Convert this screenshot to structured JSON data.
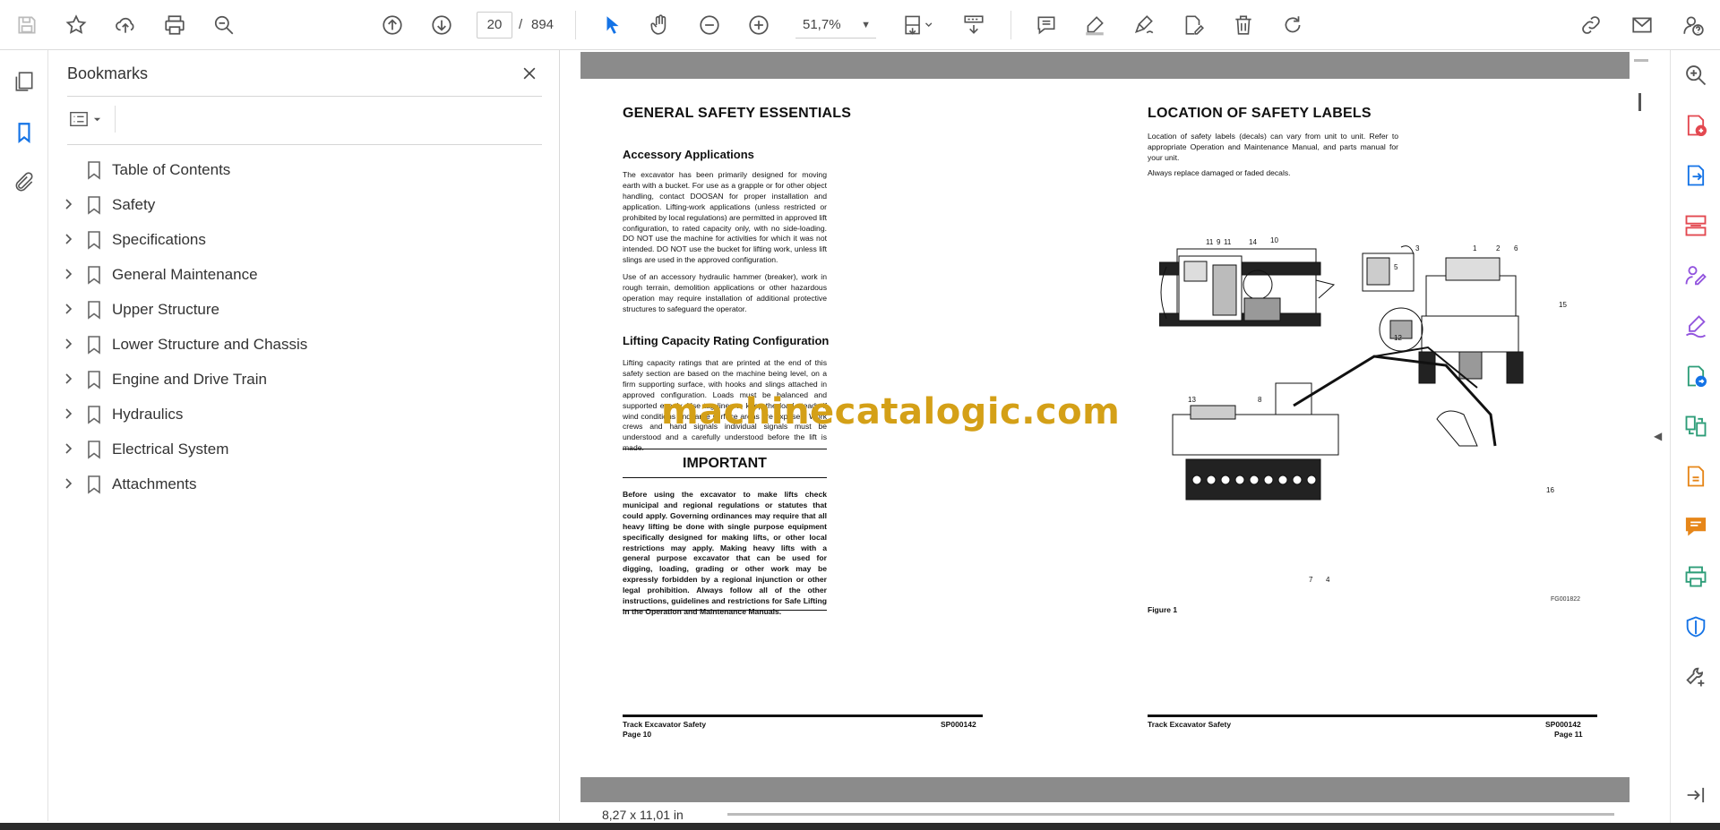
{
  "toolbar": {
    "current_page": "20",
    "page_sep": "/",
    "total_pages": "894",
    "zoom": "51,7%",
    "icons": [
      "save-icon",
      "star-icon",
      "upload-icon",
      "print-icon",
      "zoom-search-icon",
      "page-up-icon",
      "page-down-icon",
      "select-cursor-icon",
      "hand-icon",
      "zoom-out-icon",
      "zoom-in-icon",
      "fit-page-icon",
      "scroll-mode-icon",
      "comment-icon",
      "highlight-icon",
      "sign-icon",
      "fill-sign-icon",
      "delete-icon",
      "rotate-icon",
      "share-link-icon",
      "email-icon",
      "help-icon"
    ]
  },
  "bookmarks": {
    "title": "Bookmarks",
    "items": [
      {
        "label": "Table of Contents",
        "expandable": false
      },
      {
        "label": "Safety",
        "expandable": true
      },
      {
        "label": "Specifications",
        "expandable": true
      },
      {
        "label": "General Maintenance",
        "expandable": true
      },
      {
        "label": "Upper Structure",
        "expandable": true
      },
      {
        "label": "Lower Structure and Chassis",
        "expandable": true
      },
      {
        "label": "Engine and Drive Train",
        "expandable": true
      },
      {
        "label": "Hydraulics",
        "expandable": true
      },
      {
        "label": "Electrical System",
        "expandable": true
      },
      {
        "label": "Attachments",
        "expandable": true
      }
    ]
  },
  "left_page": {
    "title": "GENERAL SAFETY ESSENTIALS",
    "section1_heading": "Accessory Applications",
    "section1_para1": "The excavator has been primarily designed for moving earth with a bucket. For use as a grapple or for other object handling, contact DOOSAN for proper installation and application. Lifting-work applications (unless restricted or prohibited by local regulations) are permitted in approved lift configuration, to rated capacity only, with no side-loading. DO NOT use the machine for activities for which it was not intended. DO NOT use the bucket for lifting work, unless lift slings are used in the approved configuration.",
    "section1_para2": "Use of an accessory hydraulic hammer (breaker), work in rough terrain, demolition applications or other hazardous operation may require installation of additional protective structures to safeguard the operator.",
    "section2_heading": "Lifting Capacity Rating Configuration",
    "section2_para": "Lifting capacity ratings that are printed at the end of this safety section are based on the machine being level, on a firm supporting surface, with hooks and slings attached in approved configuration. Loads must be balanced and supported evenly. Use tag lines to keep the load steady if wind conditions and large surface areas are exposed. Work crews and hand signals individual signals must be understood and a carefully understood before the lift is made.",
    "important_heading": "IMPORTANT",
    "important_text": "Before using the excavator to make lifts check municipal and regional regulations or statutes that could apply. Governing ordinances may require that all heavy lifting be done with single purpose equipment specifically designed for making lifts, or other local restrictions may apply. Making heavy lifts with a general purpose excavator that can be used for digging, loading, grading or other work may be expressly forbidden by a regional injunction or other legal prohibition. Always follow all of the other instructions, guidelines and restrictions for Safe Lifting in the Operation and Maintenance Manuals.",
    "footer_left": "Track Excavator Safety",
    "footer_page": "Page 10",
    "footer_code": "SP000142"
  },
  "right_page": {
    "title": "LOCATION OF SAFETY LABELS",
    "para1": "Location of safety labels (decals) can vary from unit to unit. Refer to appropriate Operation and Maintenance Manual, and parts manual for your unit.",
    "para2": "Always replace damaged or faded decals.",
    "figure_caption": "Figure 1",
    "figure_code": "FG001822",
    "callouts": [
      "11",
      "9",
      "11",
      "14",
      "10",
      "13",
      "8",
      "3",
      "1",
      "2",
      "6",
      "5",
      "15",
      "12",
      "16",
      "7",
      "4"
    ],
    "footer_left": "Track Excavator Safety",
    "footer_code": "SP000142",
    "footer_page": "Page 11"
  },
  "watermark": "machinecatalogic.com",
  "status": {
    "page_size": "8,27 x 11,01 in"
  },
  "right_tools": [
    "search-zoom-icon",
    "create-pdf-icon",
    "export-pdf-icon",
    "organize-pages-icon",
    "request-signature-icon",
    "fill-sign-icon",
    "send-track-icon",
    "compare-icon",
    "edit-pdf-icon",
    "comment-icon",
    "print-production-icon",
    "protect-icon",
    "more-tools-icon",
    "expand-panel-icon"
  ],
  "colors": {
    "accent_blue": "#1473e6",
    "tool_red": "#e34850",
    "tool_purple": "#9254de",
    "tool_green": "#2d9d78",
    "tool_orange": "#e68619",
    "watermark": "#d4a017"
  }
}
